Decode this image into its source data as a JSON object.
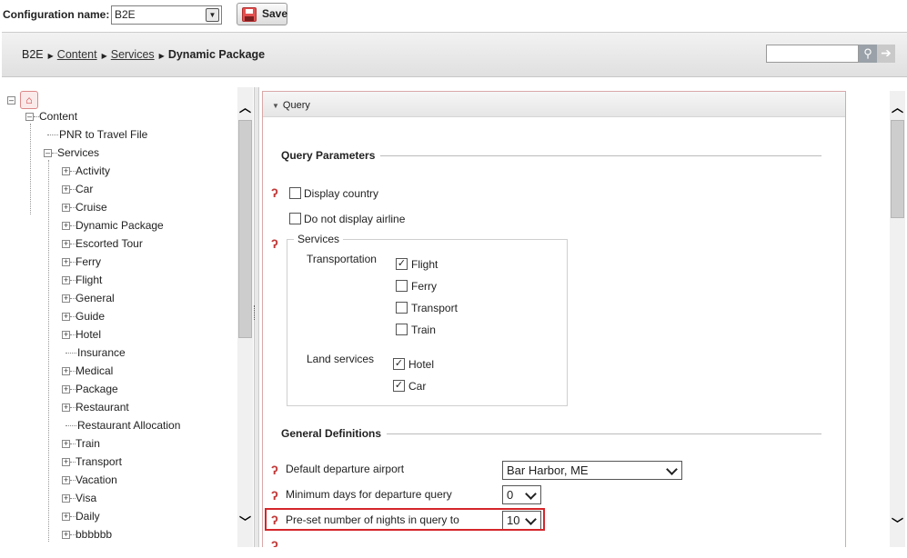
{
  "config": {
    "label": "Configuration name:",
    "selected": "B2E",
    "save_label": "Save"
  },
  "breadcrumb": {
    "root": "B2E",
    "items": [
      "Content",
      "Services"
    ],
    "current": "Dynamic Package"
  },
  "search": {
    "placeholder": "",
    "value": ""
  },
  "tree": {
    "content": "Content",
    "pnr": "PNR to Travel File",
    "services": "Services",
    "items": [
      {
        "label": "Activity",
        "expandable": true
      },
      {
        "label": "Car",
        "expandable": true
      },
      {
        "label": "Cruise",
        "expandable": true
      },
      {
        "label": "Dynamic Package",
        "expandable": true
      },
      {
        "label": "Escorted Tour",
        "expandable": true
      },
      {
        "label": "Ferry",
        "expandable": true
      },
      {
        "label": "Flight",
        "expandable": true
      },
      {
        "label": "General",
        "expandable": true
      },
      {
        "label": "Guide",
        "expandable": true
      },
      {
        "label": "Hotel",
        "expandable": true
      },
      {
        "label": "Insurance",
        "expandable": false
      },
      {
        "label": "Medical",
        "expandable": true
      },
      {
        "label": "Package",
        "expandable": true
      },
      {
        "label": "Restaurant",
        "expandable": true
      },
      {
        "label": "Restaurant Allocation",
        "expandable": false
      },
      {
        "label": "Train",
        "expandable": true
      },
      {
        "label": "Transport",
        "expandable": true
      },
      {
        "label": "Vacation",
        "expandable": true
      },
      {
        "label": "Visa",
        "expandable": true
      },
      {
        "label": "Daily",
        "expandable": true
      },
      {
        "label": "bbbbbb",
        "expandable": true
      }
    ]
  },
  "panel": {
    "header": "Query",
    "query_parameters": "Query Parameters",
    "display_country": "Display country",
    "do_not_display_airline": "Do not display airline",
    "services_legend": "Services",
    "transportation": "Transportation",
    "flight": "Flight",
    "ferry": "Ferry",
    "transport": "Transport",
    "train": "Train",
    "land_services": "Land services",
    "hotel": "Hotel",
    "car": "Car",
    "general_definitions": "General Definitions",
    "default_departure_airport": "Default departure airport",
    "default_departure_airport_value": "Bar Harbor, ME",
    "minimum_days": "Minimum days for departure query",
    "minimum_days_value": "0",
    "preset_nights": "Pre-set number of nights in query to",
    "preset_nights_value": "10"
  },
  "checks": {
    "display_country": "",
    "do_not_display_airline": "",
    "flight": "✓",
    "ferry": "",
    "transport": "",
    "train": "",
    "hotel": "✓",
    "car": "✓"
  },
  "colors": {
    "accent": "#d4262a",
    "help": "#c23b3b"
  }
}
